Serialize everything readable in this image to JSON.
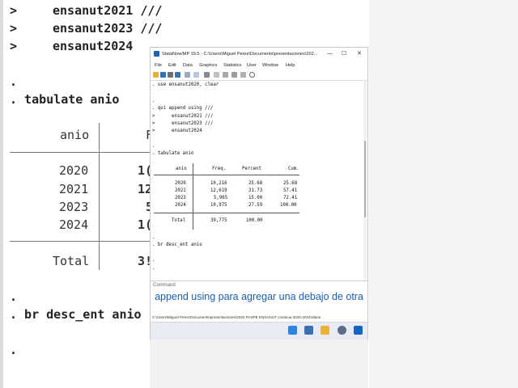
{
  "background": {
    "lines": {
      "ensanut2021": "ensanut2021 ///",
      "ensanut2023": "ensanut2023 ///",
      "ensanut2024": "ensanut2024",
      "dot1": ".",
      "tabulate": ". tabulate anio",
      "br": ". br desc_ent anio",
      "dot2": ".",
      "dot3": "."
    },
    "prompts": [
      ">",
      ">",
      ">"
    ],
    "table": {
      "header": "anio",
      "header_right": "F",
      "years": [
        "2020",
        "2021",
        "2023",
        "2024"
      ],
      "freq_partial": [
        "1(",
        "12",
        "5",
        "1("
      ],
      "total_label": "Total",
      "total_partial": "3!"
    }
  },
  "window": {
    "title": "StataNow/MP 19.5 - C:\\Users\\Miguel Perez\\Documents\\presentaciones\\202...",
    "controls": {
      "minimize": "—",
      "maximize": "☐",
      "close": "✕"
    },
    "menu": [
      "File",
      "Edit",
      "Data",
      "Graphics",
      "Statistics",
      "User",
      "Window",
      "Help"
    ],
    "toolbar_icons": [
      "open-icon",
      "save-icon",
      "print-icon",
      "log-icon",
      "viewer-icon",
      "graph-icon",
      "do-file-editor-icon",
      "data-editor-icon",
      "data-browser-icon",
      "variables-manager-icon",
      "more-icon",
      "break-icon"
    ]
  },
  "results": {
    "use_cmd": ". use ensanut2020, clear",
    "dot_a": ".",
    "append_cmd": ". qui append using ///",
    "cont_prompts": [
      ">",
      ">",
      ">"
    ],
    "cont1": "ensanut2021 ///",
    "cont2": "ensanut2023 ///",
    "cont3": "ensanut2024",
    "dot_b": ".",
    "tab_cmd": ". tabulate anio",
    "table": {
      "columns": [
        "anio",
        "Freq.",
        "Percent",
        "Cum."
      ],
      "rows": [
        [
          "2020",
          "10,216",
          "25.68",
          "25.68"
        ],
        [
          "2021",
          "12,619",
          "31.73",
          "57.41"
        ],
        [
          "2023",
          "5,965",
          "15.00",
          "72.41"
        ],
        [
          "2024",
          "10,975",
          "27.59",
          "100.00"
        ]
      ],
      "total": [
        "Total",
        "39,775",
        "100.00"
      ]
    },
    "dot_c": ".",
    "br_cmd": ". br desc_ent anio",
    "dot_d": ".",
    "dot_e": "."
  },
  "command": {
    "label": "Command",
    "caption": "append using para agregar una debajo de otra"
  },
  "status": {
    "path": "C:\\Users\\Miguel Perez\\Documents\\presentaciones\\2026 PASPE ENSANUT continua 2020-2024\\datos"
  },
  "taskbar": {
    "icons": [
      "windows-start-icon",
      "notepad-icon",
      "file-explorer-icon",
      "settings-icon",
      "outlook-icon"
    ]
  },
  "colors": {
    "caption": "#1b5fb3",
    "stata_blue": "#1e63b0"
  }
}
